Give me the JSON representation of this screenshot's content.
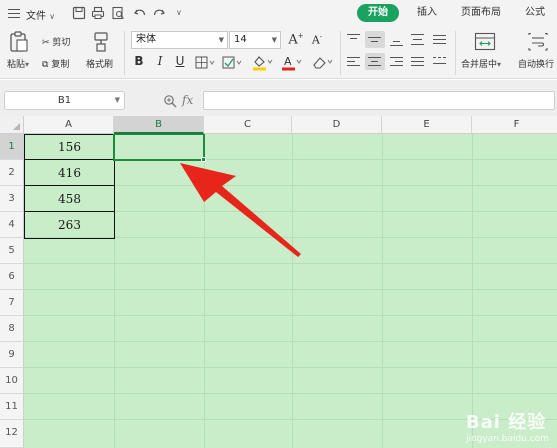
{
  "menubar": {
    "file_label": "文件",
    "tabs": [
      {
        "label": "开始",
        "active": true
      },
      {
        "label": "插入",
        "active": false
      },
      {
        "label": "页面布局",
        "active": false
      },
      {
        "label": "公式",
        "active": false
      }
    ]
  },
  "ribbon": {
    "paste_label": "粘贴",
    "cut_label": "剪切",
    "copy_label": "复制",
    "format_painter_label": "格式刷",
    "font_name": "宋体",
    "font_size": "14",
    "merge_center_label": "合并居中",
    "wrap_text_label": "自动换行"
  },
  "formula_bar": {
    "cell_ref": "B1",
    "fx_label": "fx",
    "formula_value": ""
  },
  "sheet": {
    "columns": [
      "A",
      "B",
      "C",
      "D",
      "E",
      "F"
    ],
    "selected_column": "B",
    "rows": [
      "1",
      "2",
      "3",
      "4",
      "5",
      "6",
      "7",
      "8",
      "9",
      "10",
      "11",
      "12"
    ],
    "selected_row": "1",
    "cells": {
      "A1": "156",
      "A2": "416",
      "A3": "458",
      "A4": "263",
      "B1": ""
    },
    "selected_cell": "B1",
    "background_color": "#c9ecc9",
    "selection_color": "#1c8c3c"
  },
  "annotation": {
    "type": "arrow",
    "color": "#e8251b",
    "points_to": "B1"
  },
  "watermark": {
    "text": "Bai 经验",
    "subtext": "jingyan.baidu.com"
  },
  "colors": {
    "accent": "#1ba260"
  }
}
